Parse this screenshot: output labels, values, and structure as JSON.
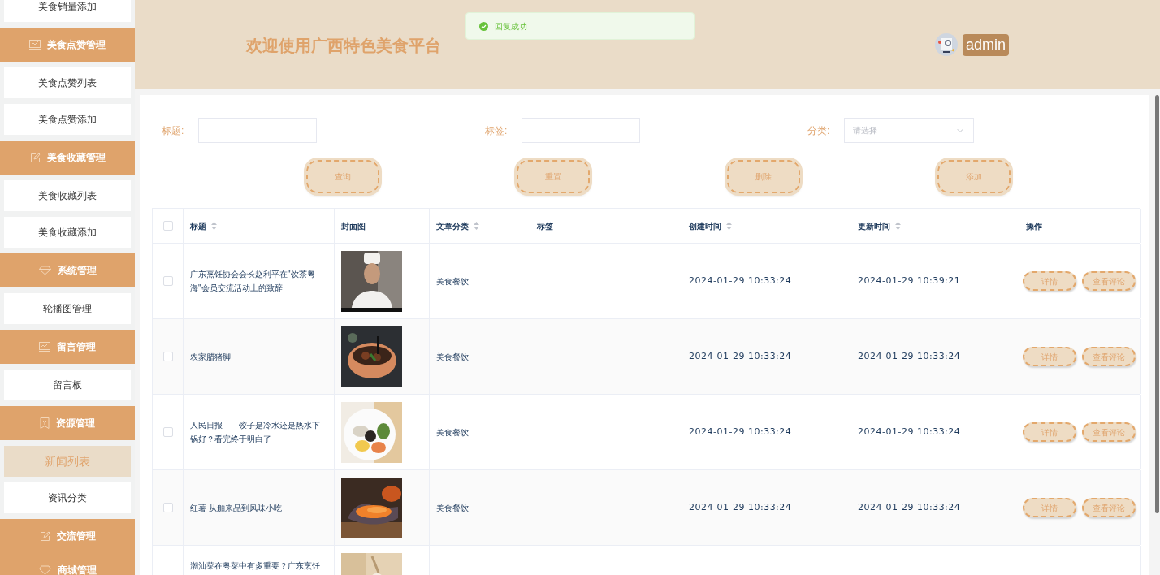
{
  "sidebar": [
    {
      "kind": "link",
      "label": "美食销量添加",
      "selected": false
    },
    {
      "kind": "group",
      "label": "美食点赞管理"
    },
    {
      "kind": "link",
      "label": "美食点赞列表",
      "selected": false
    },
    {
      "kind": "link",
      "label": "美食点赞添加",
      "selected": false
    },
    {
      "kind": "group",
      "label": "美食收藏管理"
    },
    {
      "kind": "link",
      "label": "美食收藏列表",
      "selected": false
    },
    {
      "kind": "link",
      "label": "美食收藏添加",
      "selected": false
    },
    {
      "kind": "group",
      "label": "系统管理"
    },
    {
      "kind": "link",
      "label": "轮播图管理",
      "selected": false
    },
    {
      "kind": "group",
      "label": "留言管理"
    },
    {
      "kind": "link",
      "label": "留言板",
      "selected": false
    },
    {
      "kind": "group",
      "label": "资源管理"
    },
    {
      "kind": "link",
      "label": "新闻列表",
      "selected": true
    },
    {
      "kind": "link",
      "label": "资讯分类",
      "selected": false
    },
    {
      "kind": "group",
      "label": "交流管理"
    },
    {
      "kind": "group",
      "label": "商城管理"
    }
  ],
  "header": {
    "title": "欢迎使用广西特色美食平台",
    "user": "admin"
  },
  "toast": {
    "message": "回复成功"
  },
  "search": {
    "fields": [
      {
        "kind": "input",
        "label": "标题:"
      },
      {
        "kind": "input",
        "label": "标签:"
      },
      {
        "kind": "select",
        "label": "分类:",
        "placeholder": "请选择"
      }
    ],
    "buttons": [
      "查询",
      "重置",
      "删除",
      "添加"
    ]
  },
  "table": {
    "select_all": {
      "checked": false
    },
    "columns": [
      {
        "label": "标题",
        "sortable": true
      },
      {
        "label": "封面图",
        "sortable": false
      },
      {
        "label": "文章分类",
        "sortable": true
      },
      {
        "label": "标签",
        "sortable": false
      },
      {
        "label": "创建时间",
        "sortable": true
      },
      {
        "label": "更新时间",
        "sortable": true
      },
      {
        "label": "操作",
        "sortable": false
      }
    ],
    "rows": [
      {
        "checked": false,
        "title": "广东烹饪协会会长赵利平在\"饮茶粤海\"会员交流活动上的致辞",
        "category": "美食餐饮",
        "created": "2024-01-29 10:33:24",
        "updated": "2024-01-29 10:39:21",
        "actions": [
          "详情",
          "查看评论"
        ]
      },
      {
        "checked": false,
        "title": "农家腊猪脚",
        "category": "美食餐饮",
        "created": "2024-01-29 10:33:24",
        "updated": "2024-01-29 10:33:24",
        "actions": [
          "详情",
          "查看评论"
        ]
      },
      {
        "checked": false,
        "title": "人民日报——饺子是冷水还是热水下锅好？看完终于明白了",
        "category": "美食餐饮",
        "created": "2024-01-29 10:33:24",
        "updated": "2024-01-29 10:33:24",
        "actions": [
          "详情",
          "查看评论"
        ]
      },
      {
        "checked": false,
        "title": "红薯 从舶来品到风味小吃",
        "category": "美食餐饮",
        "created": "2024-01-29 10:33:24",
        "updated": "2024-01-29 10:33:24",
        "actions": [
          "详情",
          "查看评论"
        ]
      },
      {
        "title": "潮汕菜在粤菜中有多重要？广东烹饪"
      }
    ]
  }
}
